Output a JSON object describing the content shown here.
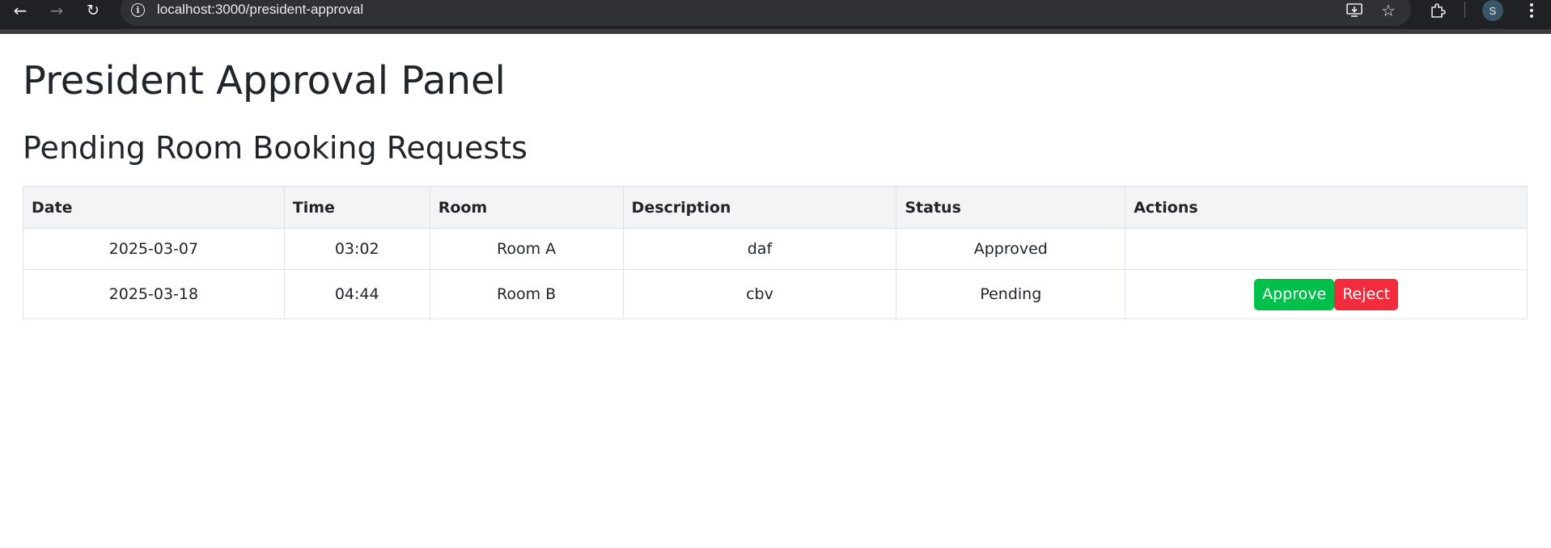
{
  "browser": {
    "url": "localhost:3000/president-approval",
    "info_glyph": "i",
    "avatar_initial": "S",
    "icons": [
      "back-arrow-icon",
      "forward-arrow-icon",
      "reload-icon",
      "site-info-icon",
      "install-app-icon",
      "bookmark-star-icon",
      "extensions-icon",
      "profile-avatar",
      "kebab-menu-icon"
    ]
  },
  "page": {
    "title": "President Approval Panel",
    "section_title": "Pending Room Booking Requests"
  },
  "table": {
    "headers": [
      "Date",
      "Time",
      "Room",
      "Description",
      "Status",
      "Actions"
    ],
    "rows": [
      {
        "date": "2025-03-07",
        "time": "03:02",
        "room": "Room A",
        "description": "daf",
        "status": "Approved"
      },
      {
        "date": "2025-03-18",
        "time": "04:44",
        "room": "Room B",
        "description": "cbv",
        "status": "Pending"
      }
    ],
    "actions": {
      "approve_label": "Approve",
      "reject_label": "Reject"
    }
  },
  "colors": {
    "approved": "#28a745",
    "pending": "#e6a817",
    "approve_button": "#00c04b",
    "reject_button": "#f22c3d",
    "header_bg": "#f3f4f6"
  }
}
